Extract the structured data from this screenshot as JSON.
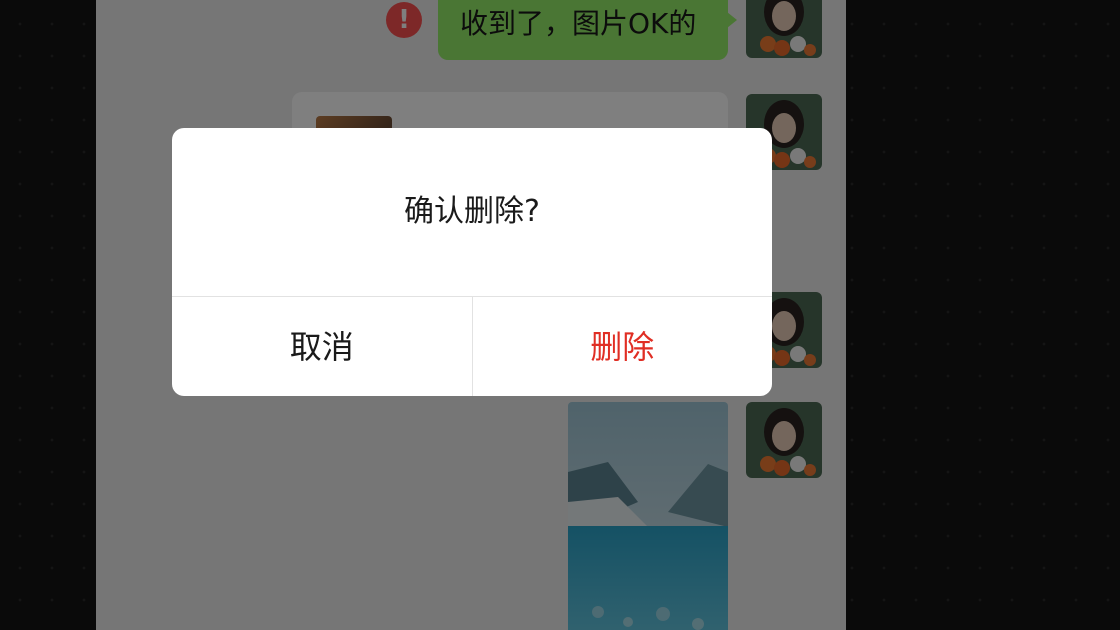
{
  "chat": {
    "messages": [
      {
        "type": "text",
        "text": "收到了，图片OK的",
        "status": "send-failed"
      },
      {
        "type": "file-card"
      },
      {
        "type": "image",
        "description": "lake-photo"
      }
    ]
  },
  "dialog": {
    "title": "确认删除?",
    "cancel_label": "取消",
    "delete_label": "删除"
  },
  "colors": {
    "bubble": "#95ec69",
    "error": "#fa5151",
    "delete_text": "#e02e24",
    "chat_background": "#ededed"
  },
  "icons": {
    "error": "exclamation-circle-icon"
  }
}
